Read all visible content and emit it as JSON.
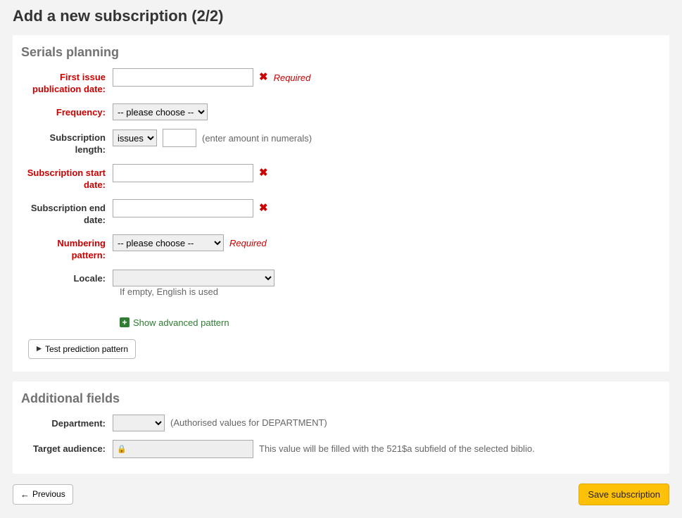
{
  "page_title": "Add a new subscription (2/2)",
  "panels": {
    "planning": {
      "legend": "Serials planning",
      "first_issue": {
        "label": "First issue publication date:",
        "value": "",
        "required_text": "Required"
      },
      "frequency": {
        "label": "Frequency:",
        "selected": "-- please choose --"
      },
      "sub_length": {
        "label": "Subscription length:",
        "unit_selected": "issues",
        "amount": "",
        "hint": "(enter amount in numerals)"
      },
      "start_date": {
        "label": "Subscription start date:",
        "value": ""
      },
      "end_date": {
        "label": "Subscription end date:",
        "value": ""
      },
      "numbering": {
        "label": "Numbering pattern:",
        "selected": "-- please choose --",
        "required_text": "Required"
      },
      "locale": {
        "label": "Locale:",
        "selected": "",
        "note": "If empty, English is used"
      },
      "advanced_toggle": "Show advanced pattern",
      "test_button": "Test prediction pattern"
    },
    "additional": {
      "legend": "Additional fields",
      "department": {
        "label": "Department:",
        "selected": "",
        "hint": "(Authorised values for DEPARTMENT)"
      },
      "target_audience": {
        "label": "Target audience:",
        "value": "",
        "hint": "This value will be filled with the 521$a subfield of the selected biblio."
      }
    }
  },
  "footer": {
    "previous": "Previous",
    "save": "Save subscription"
  }
}
